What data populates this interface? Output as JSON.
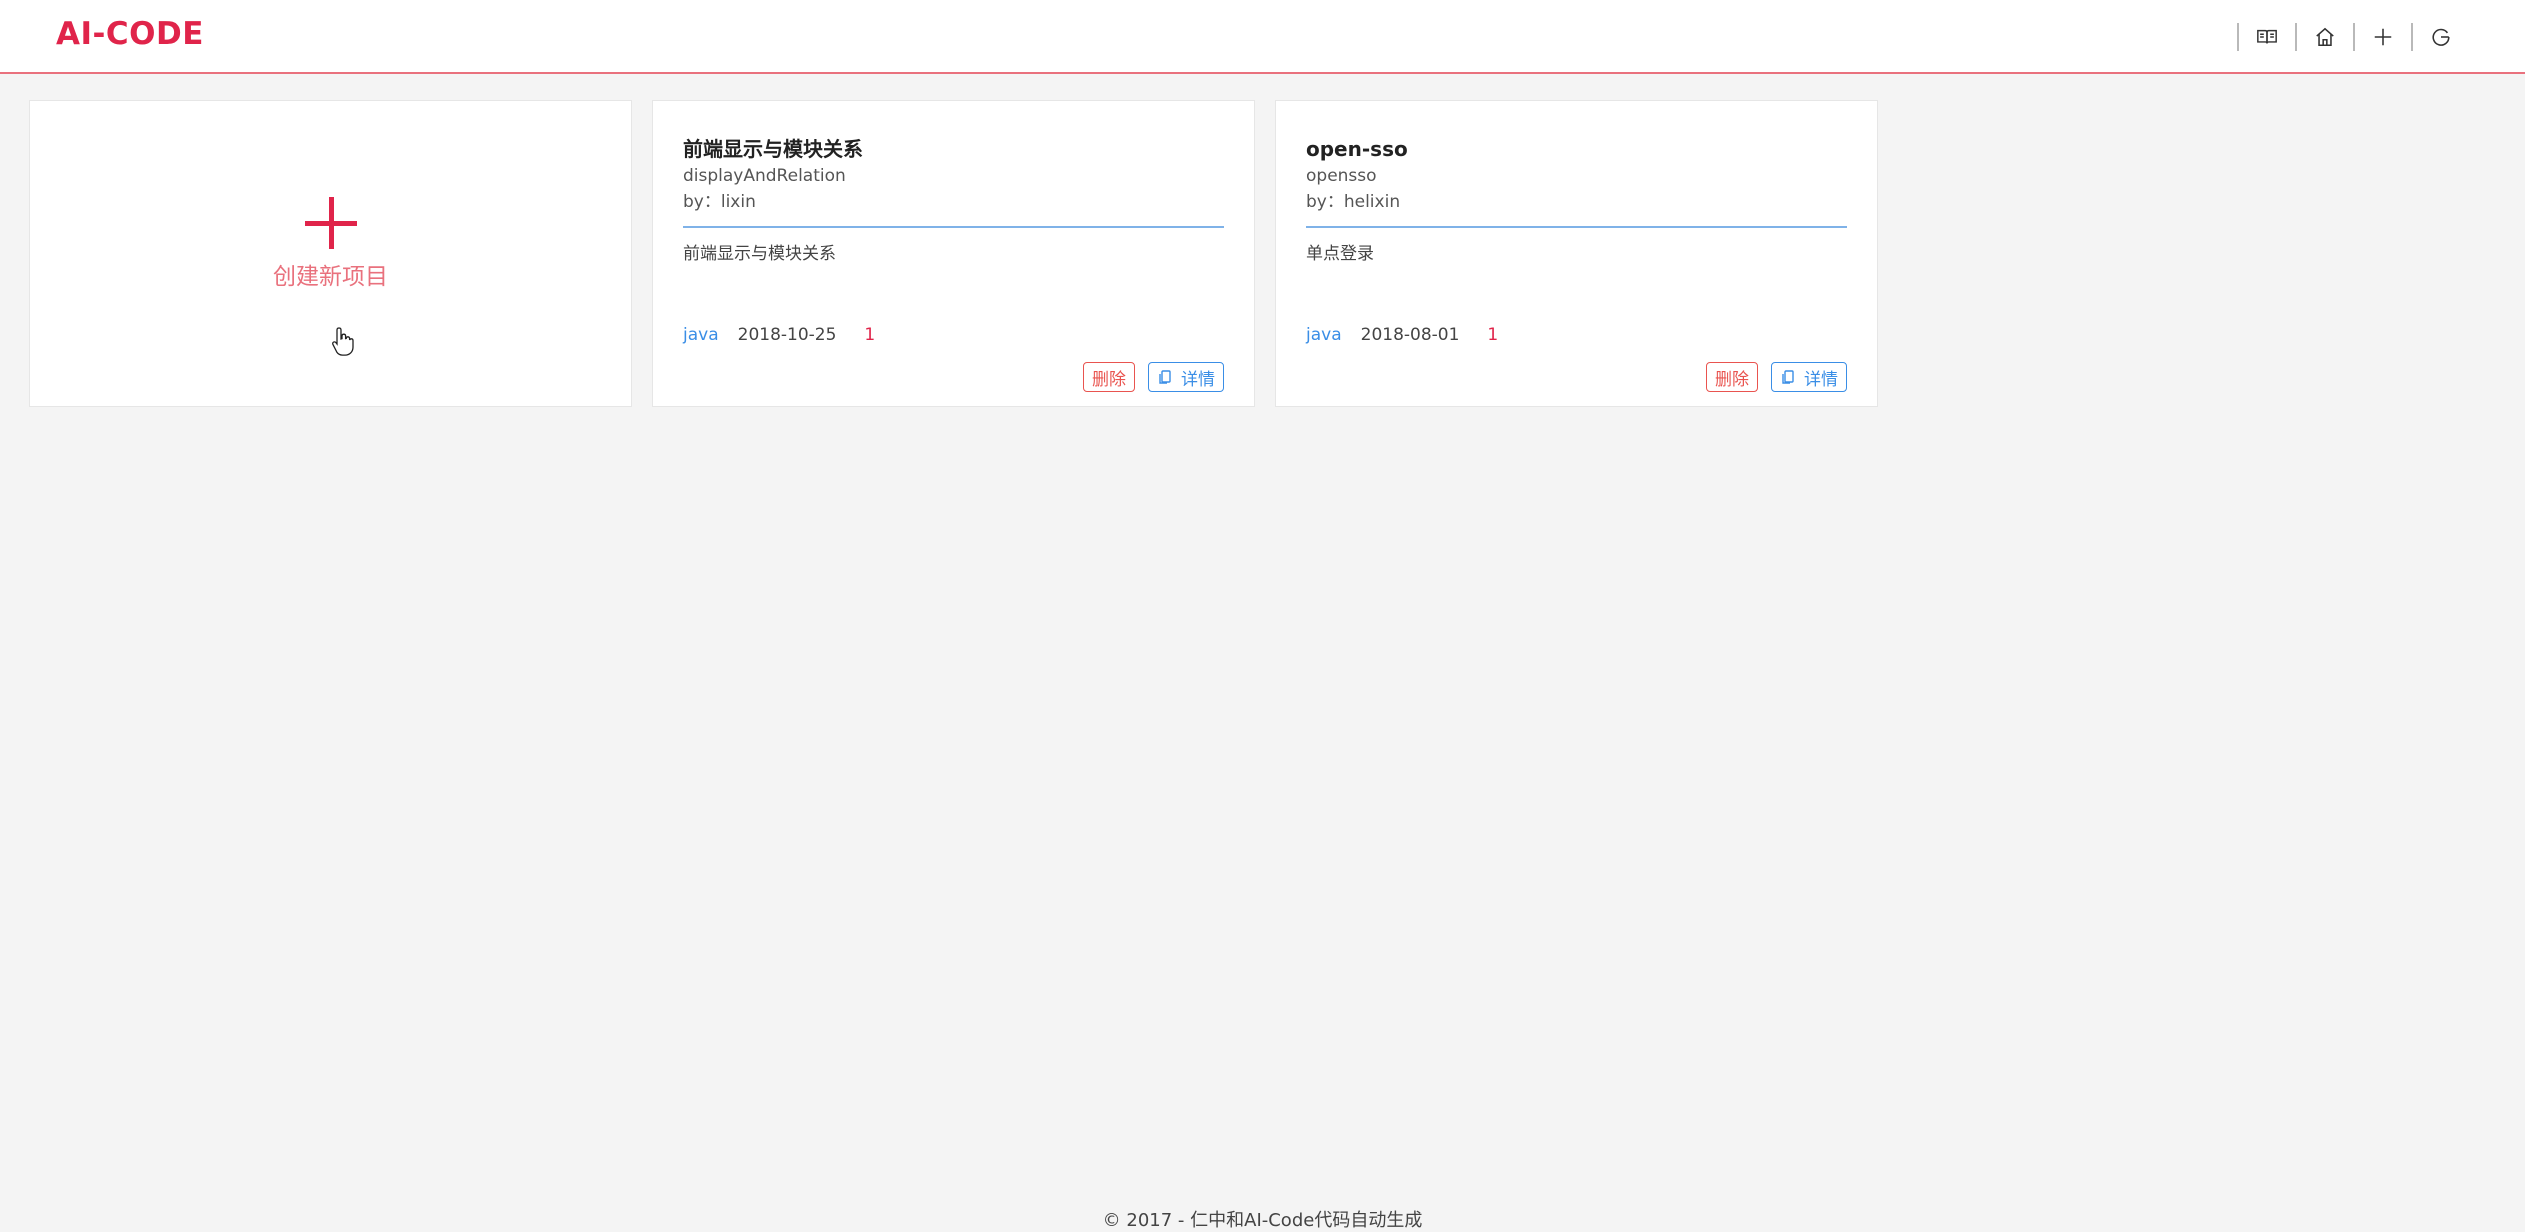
{
  "header": {
    "logo": "AI-CODE",
    "tools": [
      {
        "icon": "book-icon"
      },
      {
        "icon": "home-icon"
      },
      {
        "icon": "plus-icon"
      },
      {
        "icon": "logout-icon"
      }
    ]
  },
  "create_card": {
    "label": "创建新项目",
    "icon": "plus-icon"
  },
  "projects": [
    {
      "title": "前端显示与模块关系",
      "code": "displayAndRelation",
      "author": "by：lixin",
      "description": "前端显示与模块关系",
      "language": "java",
      "date": "2018-10-25",
      "count": "1",
      "delete_label": "删除",
      "detail_label": "详情"
    },
    {
      "title": "open-sso",
      "code": "opensso",
      "author": "by：helixin",
      "description": "单点登录",
      "language": "java",
      "date": "2018-08-01",
      "count": "1",
      "delete_label": "删除",
      "detail_label": "详情"
    }
  ],
  "footer": {
    "text": "© 2017 - 仁中和AI-Code代码自动生成"
  },
  "colors": {
    "brand": "#e0244a",
    "accent": "#3a8ee6",
    "danger": "#e9544f"
  }
}
